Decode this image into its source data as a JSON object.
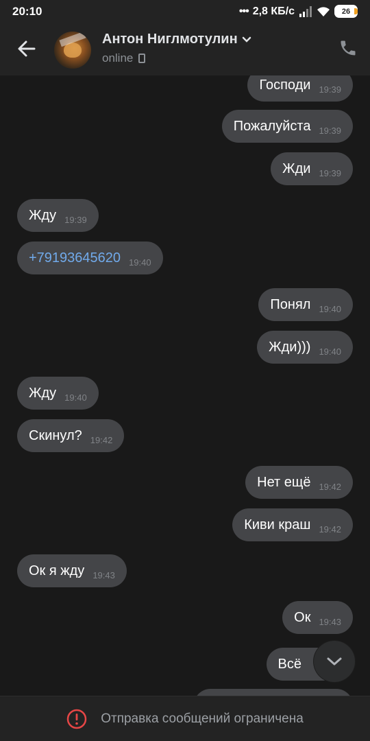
{
  "status_bar": {
    "time": "20:10",
    "network_speed": "2,8 КБ/с",
    "battery": "26"
  },
  "header": {
    "contact_name": "Антон Ниглмотулин",
    "status": "online"
  },
  "messages": [
    {
      "direction": "out",
      "text": "Господи",
      "time": "19:39"
    },
    {
      "direction": "out",
      "text": "Пожалуйста",
      "time": "19:39"
    },
    {
      "direction": "out",
      "text": "Жди",
      "time": "19:39"
    },
    {
      "direction": "in",
      "text": "Жду",
      "time": "19:39"
    },
    {
      "direction": "in",
      "text": "+79193645620",
      "time": "19:40",
      "link": true
    },
    {
      "direction": "out",
      "text": "Понял",
      "time": "19:40"
    },
    {
      "direction": "out",
      "text": "Жди)))",
      "time": "19:40"
    },
    {
      "direction": "in",
      "text": "Жду",
      "time": "19:40"
    },
    {
      "direction": "in",
      "text": "Скинул?",
      "time": "19:42"
    },
    {
      "direction": "out",
      "text": "Нет ещё",
      "time": "19:42"
    },
    {
      "direction": "out",
      "text": "Киви краш",
      "time": "19:42"
    },
    {
      "direction": "in",
      "text": "Ок я жду",
      "time": "19:43"
    },
    {
      "direction": "out",
      "text": "Ок",
      "time": "19:43"
    },
    {
      "direction": "out",
      "text": "Всё",
      "time": ""
    }
  ],
  "footer": {
    "restriction_text": "Отправка сообщений ограничена"
  },
  "icons": {
    "back": "arrow-left-icon",
    "phone": "phone-icon",
    "scroll_down": "chevron-down-icon",
    "warning": "warning-icon"
  },
  "colors": {
    "background": "#191919",
    "bubble": "#444548",
    "link": "#71aaeb",
    "warning": "#e64646"
  }
}
